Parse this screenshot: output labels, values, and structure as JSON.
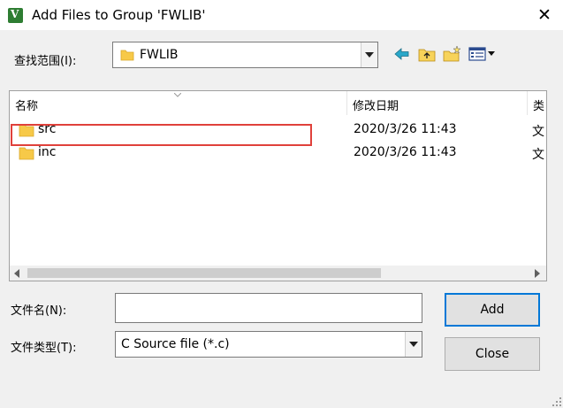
{
  "window": {
    "title": "Add Files to Group 'FWLIB'",
    "close_glyph": "✕"
  },
  "look_in": {
    "label": "查找范围(I):",
    "value": "FWLIB"
  },
  "toolbar": {
    "icons": [
      "back-icon",
      "up-folder-icon",
      "new-folder-icon",
      "view-menu-icon"
    ]
  },
  "list": {
    "columns": [
      "名称",
      "修改日期",
      "类"
    ],
    "rows": [
      {
        "name": "src",
        "date": "2020/3/26 11:43",
        "type": "文"
      },
      {
        "name": "inc",
        "date": "2020/3/26 11:43",
        "type": "文"
      }
    ]
  },
  "file_name": {
    "label": "文件名(N):",
    "value": ""
  },
  "file_type": {
    "label": "文件类型(T):",
    "value": "C Source file (*.c)"
  },
  "buttons": {
    "add": "Add",
    "close": "Close"
  },
  "colors": {
    "highlight_box": "#e0413b",
    "folder": "#f7c948",
    "accent": "#0078d7"
  }
}
